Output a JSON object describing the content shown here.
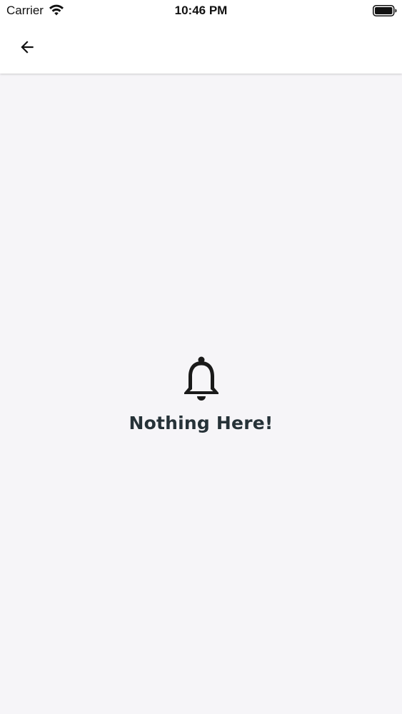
{
  "status_bar": {
    "carrier": "Carrier",
    "time": "10:46 PM",
    "wifi_icon": "wifi-icon",
    "battery_icon": "battery-icon"
  },
  "header": {
    "back_icon": "arrow-left-icon"
  },
  "empty_state": {
    "icon": "bell-icon",
    "title": "Nothing Here!"
  },
  "colors": {
    "background": "#f6f5f8",
    "app_bar": "#ffffff",
    "title_text": "#263238",
    "icon": "#1a1a1a"
  }
}
